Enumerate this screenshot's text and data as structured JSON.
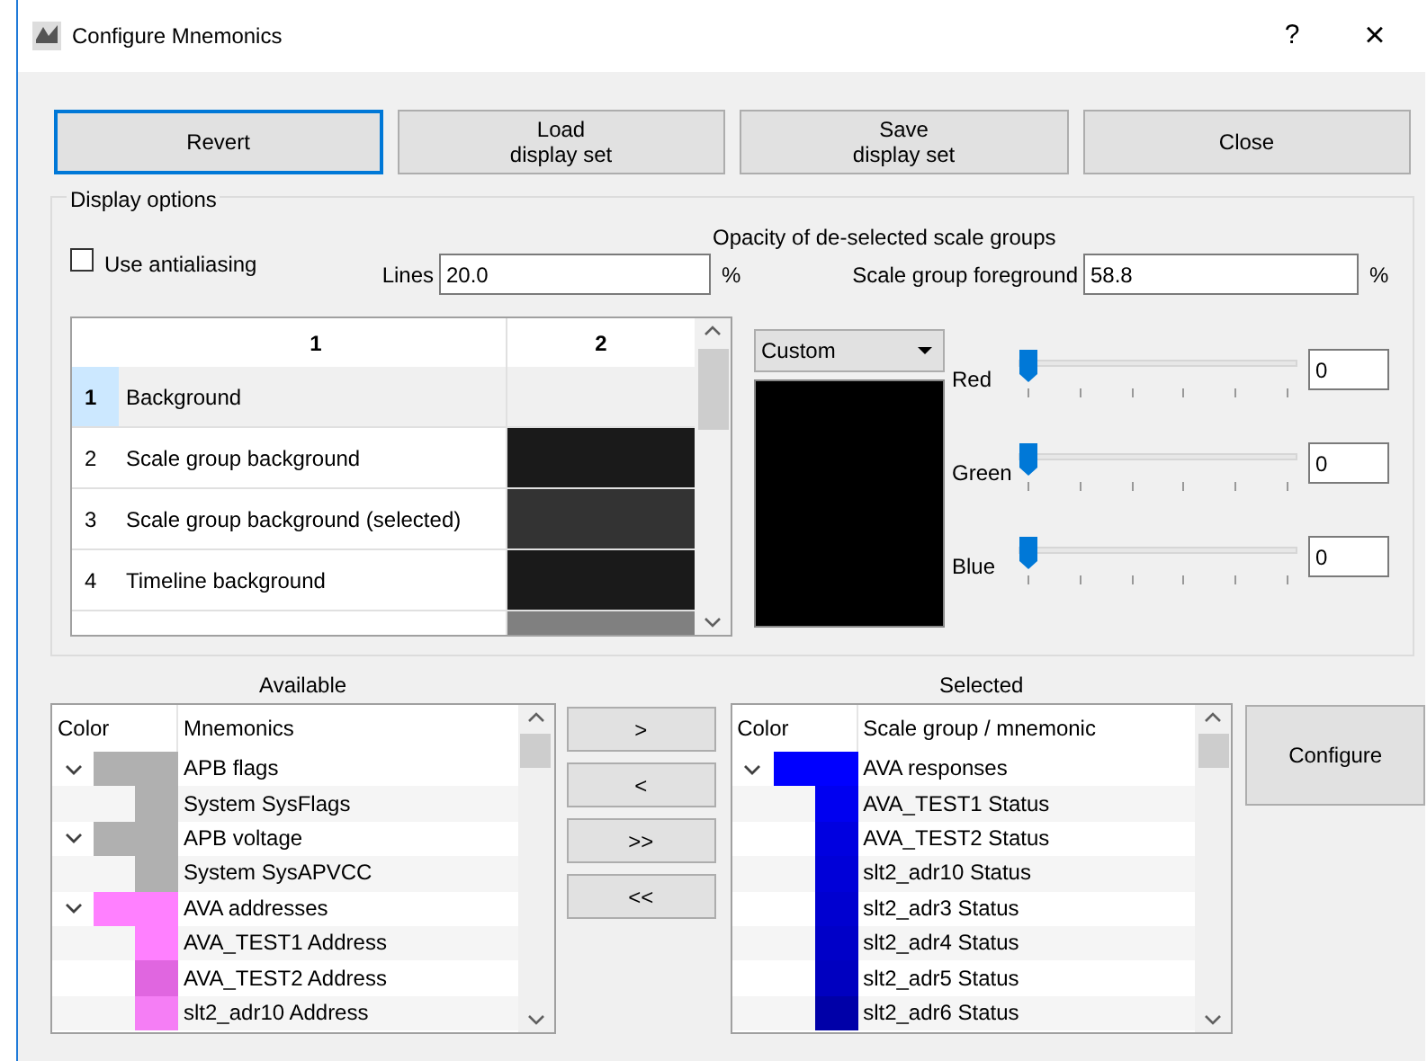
{
  "window": {
    "title": "Configure Mnemonics",
    "help": "?",
    "close": "×"
  },
  "buttons": [
    {
      "label": "Revert",
      "focused": true
    },
    {
      "label": "Load\ndisplay set",
      "focused": false
    },
    {
      "label": "Save\ndisplay set",
      "focused": false
    },
    {
      "label": "Close",
      "focused": false
    }
  ],
  "display_options": {
    "title": "Display options",
    "antialiasing": {
      "label": "Use antialiasing",
      "checked": false
    },
    "opacity_title": "Opacity of de-selected scale groups",
    "lines": {
      "label": "Lines",
      "value": "20.0",
      "unit": "%"
    },
    "foreground": {
      "label": "Scale group foreground",
      "value": "58.8",
      "unit": "%"
    },
    "color_table": {
      "columns": [
        "1",
        "2"
      ],
      "rows": [
        {
          "number": "1",
          "label": "Background",
          "color": "#f0f0f0",
          "selected": true
        },
        {
          "number": "2",
          "label": "Scale group background",
          "color": "#1a1a1a",
          "selected": false
        },
        {
          "number": "3",
          "label": "Scale group background (selected)",
          "color": "#333333",
          "selected": false
        },
        {
          "number": "4",
          "label": "Timeline background",
          "color": "#1a1a1a",
          "selected": false
        },
        {
          "color": "#808080",
          "selected": false
        }
      ]
    },
    "preset": "Custom",
    "channels": [
      {
        "name": "Red",
        "level": 0,
        "value": "0"
      },
      {
        "name": "Green",
        "level": 0,
        "value": "0"
      },
      {
        "name": "Blue",
        "level": 0,
        "value": "0"
      }
    ]
  },
  "available": {
    "title": "Available",
    "columns": [
      "Color",
      "Mnemonics"
    ],
    "items": [
      {
        "label": "APB flags",
        "color": "#b0b0b0",
        "expanded": true,
        "children": [
          {
            "label": "System SysFlags",
            "color": "#b0b0b0"
          }
        ]
      },
      {
        "label": "APB voltage",
        "color": "#b0b0b0",
        "expanded": true,
        "children": [
          {
            "label": "System SysAPVCC",
            "color": "#b0b0b0"
          }
        ]
      },
      {
        "label": "AVA addresses",
        "color": "#ff80ff",
        "expanded": true,
        "children": [
          {
            "label": "AVA_TEST1 Address",
            "color": "#ff80ff"
          },
          {
            "label": "AVA_TEST2 Address",
            "color": "#e066e0"
          },
          {
            "label": "slt2_adr10 Address",
            "color": "#f57ef5"
          }
        ]
      }
    ]
  },
  "transfer_buttons": [
    ">",
    "<",
    ">>",
    "<<"
  ],
  "selected": {
    "title": "Selected",
    "columns": [
      "Color",
      "Scale group / mnemonic"
    ],
    "items": [
      {
        "label": "AVA responses",
        "color": "#0000ff",
        "expanded": true,
        "children": [
          {
            "label": "AVA_TEST1 Status",
            "color": "#0000f0"
          },
          {
            "label": "AVA_TEST2 Status",
            "color": "#0000e0"
          },
          {
            "label": "slt2_adr10 Status",
            "color": "#0000d8"
          },
          {
            "label": "slt2_adr3 Status",
            "color": "#0000d0"
          },
          {
            "label": "slt2_adr4 Status",
            "color": "#0000c8"
          },
          {
            "label": "slt2_adr5 Status",
            "color": "#0000c0"
          },
          {
            "label": "slt2_adr6 Status",
            "color": "#0000a8"
          }
        ]
      }
    ]
  },
  "configure": "Configure"
}
